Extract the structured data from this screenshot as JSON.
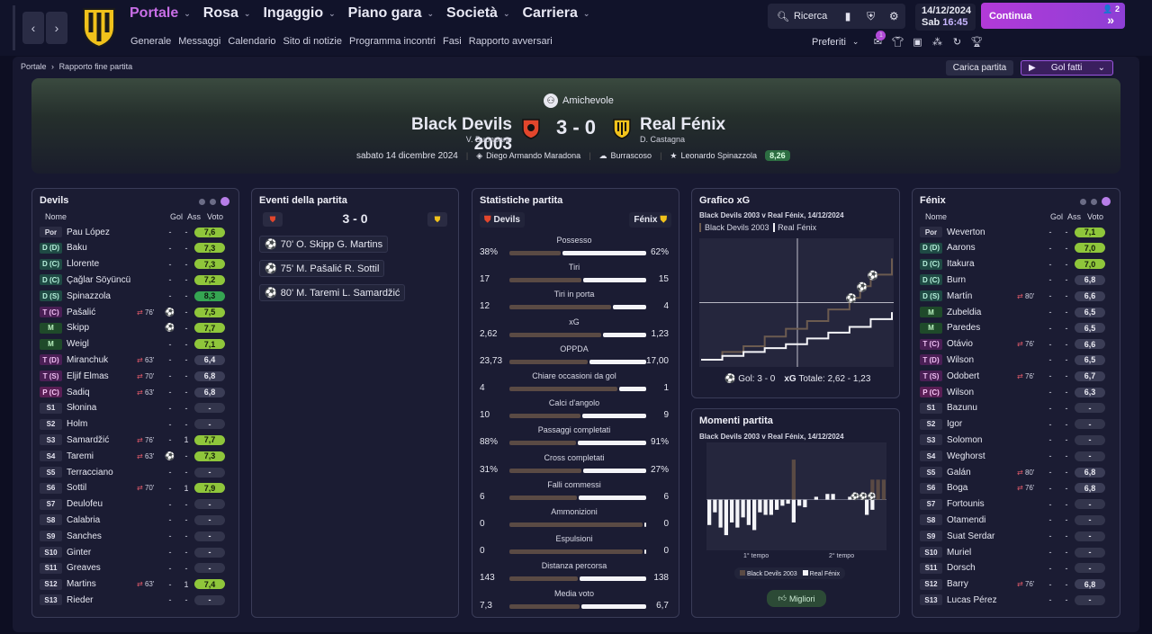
{
  "nav": {
    "menu": [
      {
        "label": "Portale",
        "active": true
      },
      {
        "label": "Rosa"
      },
      {
        "label": "Ingaggio"
      },
      {
        "label": "Piano gara"
      },
      {
        "label": "Società"
      },
      {
        "label": "Carriera"
      }
    ],
    "submenu": [
      "Generale",
      "Messaggi",
      "Calendario",
      "Sito di notizie",
      "Programma incontri",
      "Fasi",
      "Rapporto avversari"
    ],
    "search_label": "Ricerca",
    "date": "14/12/2024",
    "day": "Sab",
    "time": "16:45",
    "continue_label": "Continua",
    "continue_badge": "2",
    "favorites_label": "Preferiti",
    "notif_count": "1"
  },
  "breadcrumb": [
    "Portale",
    "Rapporto fine partita"
  ],
  "actions": {
    "load_match": "Carica partita",
    "goals_button": "Gol fatti"
  },
  "match": {
    "competition": "Amichevole",
    "home": "Black Devils 2003",
    "home_manager": "V. Buonpane",
    "away": "Real Fénix",
    "away_manager": "D. Castagna",
    "score": "3 - 0",
    "date": "sabato 14 dicembre 2024",
    "stadium": "Diego Armando Maradona",
    "weather": "Burrascoso",
    "mvp": "Leonardo Spinazzola",
    "mvp_rating": "8,26"
  },
  "home_panel": {
    "title": "Devils",
    "headers": {
      "name": "Nome",
      "gol": "Gol",
      "ass": "Ass",
      "voto": "Voto"
    },
    "players": [
      {
        "pos": "Por",
        "name": "Pau López",
        "sub": "",
        "gol": "-",
        "ass": "-",
        "voto": "7,6",
        "cls": "gk"
      },
      {
        "pos": "D (D)",
        "name": "Baku",
        "sub": "",
        "gol": "-",
        "ass": "-",
        "voto": "7,3",
        "cls": "d"
      },
      {
        "pos": "D (C)",
        "name": "Llorente",
        "sub": "",
        "gol": "-",
        "ass": "-",
        "voto": "7,3",
        "cls": "d"
      },
      {
        "pos": "D (C)",
        "name": "Çağlar Söyüncü",
        "sub": "",
        "gol": "-",
        "ass": "-",
        "voto": "7,2",
        "cls": "d"
      },
      {
        "pos": "D (S)",
        "name": "Spinazzola",
        "sub": "",
        "gol": "-",
        "ass": "-",
        "voto": "8,3",
        "cls": "d"
      },
      {
        "pos": "T (C)",
        "name": "Pašalić",
        "sub": "76'",
        "gol": "⚽",
        "ass": "-",
        "voto": "7,5",
        "cls": "t"
      },
      {
        "pos": "M",
        "name": "Skipp",
        "sub": "",
        "gol": "⚽",
        "ass": "-",
        "voto": "7,7",
        "cls": "m"
      },
      {
        "pos": "M",
        "name": "Weigl",
        "sub": "",
        "gol": "-",
        "ass": "-",
        "voto": "7,1",
        "cls": "m"
      },
      {
        "pos": "T (D)",
        "name": "Miranchuk",
        "sub": "63'",
        "gol": "-",
        "ass": "-",
        "voto": "6,4",
        "cls": "t"
      },
      {
        "pos": "T (S)",
        "name": "Eljif Elmas",
        "sub": "70'",
        "gol": "-",
        "ass": "-",
        "voto": "6,8",
        "cls": "t"
      },
      {
        "pos": "P (C)",
        "name": "Sadiq",
        "sub": "63'",
        "gol": "-",
        "ass": "-",
        "voto": "6,8",
        "cls": "p"
      },
      {
        "pos": "S1",
        "name": "Słonina",
        "sub": "",
        "gol": "-",
        "ass": "-",
        "voto": "-",
        "cls": "s"
      },
      {
        "pos": "S2",
        "name": "Holm",
        "sub": "",
        "gol": "-",
        "ass": "-",
        "voto": "-",
        "cls": "s"
      },
      {
        "pos": "S3",
        "name": "Samardžić",
        "sub": "76'",
        "gol": "-",
        "ass": "1",
        "voto": "7,7",
        "cls": "s"
      },
      {
        "pos": "S4",
        "name": "Taremi",
        "sub": "63'",
        "gol": "⚽",
        "ass": "-",
        "voto": "7,3",
        "cls": "s"
      },
      {
        "pos": "S5",
        "name": "Terracciano",
        "sub": "",
        "gol": "-",
        "ass": "-",
        "voto": "-",
        "cls": "s"
      },
      {
        "pos": "S6",
        "name": "Sottil",
        "sub": "70'",
        "gol": "-",
        "ass": "1",
        "voto": "7,9",
        "cls": "s"
      },
      {
        "pos": "S7",
        "name": "Deulofeu",
        "sub": "",
        "gol": "-",
        "ass": "-",
        "voto": "-",
        "cls": "s"
      },
      {
        "pos": "S8",
        "name": "Calabria",
        "sub": "",
        "gol": "-",
        "ass": "-",
        "voto": "-",
        "cls": "s"
      },
      {
        "pos": "S9",
        "name": "Sanches",
        "sub": "",
        "gol": "-",
        "ass": "-",
        "voto": "-",
        "cls": "s"
      },
      {
        "pos": "S10",
        "name": "Ginter",
        "sub": "",
        "gol": "-",
        "ass": "-",
        "voto": "-",
        "cls": "s"
      },
      {
        "pos": "S11",
        "name": "Greaves",
        "sub": "",
        "gol": "-",
        "ass": "-",
        "voto": "-",
        "cls": "s"
      },
      {
        "pos": "S12",
        "name": "Martins",
        "sub": "63'",
        "gol": "-",
        "ass": "1",
        "voto": "7,4",
        "cls": "s"
      },
      {
        "pos": "S13",
        "name": "Rieder",
        "sub": "",
        "gol": "-",
        "ass": "-",
        "voto": "-",
        "cls": "s"
      }
    ]
  },
  "away_panel": {
    "title": "Fénix",
    "headers": {
      "name": "Nome",
      "gol": "Gol",
      "ass": "Ass",
      "voto": "Voto"
    },
    "players": [
      {
        "pos": "Por",
        "name": "Weverton",
        "sub": "",
        "gol": "-",
        "ass": "-",
        "voto": "7,1",
        "cls": "gk"
      },
      {
        "pos": "D (D)",
        "name": "Aarons",
        "sub": "",
        "gol": "-",
        "ass": "-",
        "voto": "7,0",
        "cls": "d"
      },
      {
        "pos": "D (C)",
        "name": "Itakura",
        "sub": "",
        "gol": "-",
        "ass": "-",
        "voto": "7,0",
        "cls": "d"
      },
      {
        "pos": "D (C)",
        "name": "Burn",
        "sub": "",
        "gol": "-",
        "ass": "-",
        "voto": "6,8",
        "cls": "d"
      },
      {
        "pos": "D (S)",
        "name": "Martín",
        "sub": "80'",
        "gol": "-",
        "ass": "-",
        "voto": "6,6",
        "cls": "d"
      },
      {
        "pos": "M",
        "name": "Zubeldia",
        "sub": "",
        "gol": "-",
        "ass": "-",
        "voto": "6,5",
        "cls": "m"
      },
      {
        "pos": "M",
        "name": "Paredes",
        "sub": "",
        "gol": "-",
        "ass": "-",
        "voto": "6,5",
        "cls": "m"
      },
      {
        "pos": "T (C)",
        "name": "Otávio",
        "sub": "76'",
        "gol": "-",
        "ass": "-",
        "voto": "6,6",
        "cls": "t"
      },
      {
        "pos": "T (D)",
        "name": "Wilson",
        "sub": "",
        "gol": "-",
        "ass": "-",
        "voto": "6,5",
        "cls": "t"
      },
      {
        "pos": "T (S)",
        "name": "Odobert",
        "sub": "76'",
        "gol": "-",
        "ass": "-",
        "voto": "6,7",
        "cls": "t"
      },
      {
        "pos": "P (C)",
        "name": "Wilson",
        "sub": "",
        "gol": "-",
        "ass": "-",
        "voto": "6,3",
        "cls": "p"
      },
      {
        "pos": "S1",
        "name": "Bazunu",
        "sub": "",
        "gol": "-",
        "ass": "-",
        "voto": "-",
        "cls": "s"
      },
      {
        "pos": "S2",
        "name": "Igor",
        "sub": "",
        "gol": "-",
        "ass": "-",
        "voto": "-",
        "cls": "s"
      },
      {
        "pos": "S3",
        "name": "Solomon",
        "sub": "",
        "gol": "-",
        "ass": "-",
        "voto": "-",
        "cls": "s"
      },
      {
        "pos": "S4",
        "name": "Weghorst",
        "sub": "",
        "gol": "-",
        "ass": "-",
        "voto": "-",
        "cls": "s"
      },
      {
        "pos": "S5",
        "name": "Galán",
        "sub": "80'",
        "gol": "-",
        "ass": "-",
        "voto": "6,8",
        "cls": "s"
      },
      {
        "pos": "S6",
        "name": "Boga",
        "sub": "76'",
        "gol": "-",
        "ass": "-",
        "voto": "6,8",
        "cls": "s"
      },
      {
        "pos": "S7",
        "name": "Fortounis",
        "sub": "",
        "gol": "-",
        "ass": "-",
        "voto": "-",
        "cls": "s"
      },
      {
        "pos": "S8",
        "name": "Otamendi",
        "sub": "",
        "gol": "-",
        "ass": "-",
        "voto": "-",
        "cls": "s"
      },
      {
        "pos": "S9",
        "name": "Suat Serdar",
        "sub": "",
        "gol": "-",
        "ass": "-",
        "voto": "-",
        "cls": "s"
      },
      {
        "pos": "S10",
        "name": "Muriel",
        "sub": "",
        "gol": "-",
        "ass": "-",
        "voto": "-",
        "cls": "s"
      },
      {
        "pos": "S11",
        "name": "Dorsch",
        "sub": "",
        "gol": "-",
        "ass": "-",
        "voto": "-",
        "cls": "s"
      },
      {
        "pos": "S12",
        "name": "Barry",
        "sub": "76'",
        "gol": "-",
        "ass": "-",
        "voto": "6,8",
        "cls": "s"
      },
      {
        "pos": "S13",
        "name": "Lucas Pérez",
        "sub": "",
        "gol": "-",
        "ass": "-",
        "voto": "-",
        "cls": "s"
      }
    ]
  },
  "events": {
    "title": "Eventi della partita",
    "score": "3 - 0",
    "list": [
      {
        "text": "70' O. Skipp G. Martins"
      },
      {
        "text": "75' M. Pašalić R. Sottil"
      },
      {
        "text": "80' M. Taremi L. Samardžić"
      }
    ]
  },
  "stats": {
    "title": "Statistiche partita",
    "home": "Devils",
    "away": "Fénix",
    "rows": [
      {
        "label": "Possesso",
        "home": "38%",
        "away": "62%",
        "h": 38,
        "a": 62
      },
      {
        "label": "Tiri",
        "home": "17",
        "away": "15",
        "h": 17,
        "a": 15
      },
      {
        "label": "Tiri in porta",
        "home": "12",
        "away": "4",
        "h": 12,
        "a": 4
      },
      {
        "label": "xG",
        "home": "2,62",
        "away": "1,23",
        "h": 2.62,
        "a": 1.23
      },
      {
        "label": "OPPDA",
        "home": "23,73",
        "away": "17,00",
        "h": 23.73,
        "a": 17.0
      },
      {
        "label": "Chiare occasioni da gol",
        "home": "4",
        "away": "1",
        "h": 4,
        "a": 1
      },
      {
        "label": "Calci d'angolo",
        "home": "10",
        "away": "9",
        "h": 10,
        "a": 9
      },
      {
        "label": "Passaggi completati",
        "home": "88%",
        "away": "91%",
        "h": 88,
        "a": 91
      },
      {
        "label": "Cross completati",
        "home": "31%",
        "away": "27%",
        "h": 31,
        "a": 27
      },
      {
        "label": "Falli commessi",
        "home": "6",
        "away": "6",
        "h": 6,
        "a": 6
      },
      {
        "label": "Ammonizioni",
        "home": "0",
        "away": "0",
        "h": 0,
        "a": 0
      },
      {
        "label": "Espulsioni",
        "home": "0",
        "away": "0",
        "h": 0,
        "a": 0
      },
      {
        "label": "Distanza percorsa",
        "home": "143",
        "away": "138",
        "h": 143,
        "a": 138
      },
      {
        "label": "Media voto",
        "home": "7,3",
        "away": "6,7",
        "h": 7.3,
        "a": 6.7
      }
    ]
  },
  "xg": {
    "title": "Grafico xG",
    "subtitle": "Black Devils 2003 v Real Fénix, 14/12/2024",
    "legend_home": "Black Devils 2003",
    "legend_away": "Real Fénix",
    "footer_goals": "Gol: 3 - 0",
    "footer_xg": "Totale: 2,62 - 1,23"
  },
  "momentum": {
    "title": "Momenti partita",
    "subtitle": "Black Devils 2003 v Real Fénix, 14/12/2024",
    "first_half": "1° tempo",
    "second_half": "2° tempo",
    "legend_home": "Black Devils 2003",
    "legend_away": "Real Fénix",
    "button": "Migliori"
  },
  "chart_data": [
    {
      "type": "line",
      "title": "Grafico xG",
      "series": [
        {
          "name": "Black Devils 2003",
          "x": [
            0,
            10,
            20,
            30,
            40,
            50,
            60,
            70,
            75,
            80,
            90
          ],
          "y": [
            0,
            0.2,
            0.35,
            0.6,
            0.8,
            1.0,
            1.3,
            1.6,
            1.9,
            2.2,
            2.62
          ]
        },
        {
          "name": "Real Fénix",
          "x": [
            0,
            10,
            20,
            30,
            40,
            50,
            60,
            70,
            80,
            90
          ],
          "y": [
            0,
            0.1,
            0.2,
            0.3,
            0.4,
            0.55,
            0.7,
            0.85,
            1.05,
            1.23
          ]
        }
      ],
      "goals": [
        {
          "team": "Black Devils 2003",
          "minute": 70
        },
        {
          "team": "Black Devils 2003",
          "minute": 75
        },
        {
          "team": "Black Devils 2003",
          "minute": 80
        }
      ]
    },
    {
      "type": "bar",
      "title": "Momenti partita",
      "series": [
        {
          "name": "Black Devils 2003",
          "values": [
            0,
            0,
            0,
            0,
            0,
            0,
            0,
            0,
            0,
            0,
            0,
            0,
            0,
            0,
            0,
            0.7,
            0,
            0,
            0,
            0,
            0,
            0,
            0,
            0,
            0,
            0,
            0,
            0,
            0,
            0.35,
            0.35,
            0.35
          ]
        },
        {
          "name": "Real Fénix",
          "values": [
            -0.5,
            -0.25,
            -0.55,
            -0.7,
            -0.45,
            -0.55,
            -0.35,
            -0.5,
            -0.6,
            -0.25,
            -0.3,
            -0.3,
            -0.2,
            -0.12,
            -0.08,
            -0.45,
            -0.12,
            -0.15,
            0,
            0.05,
            0,
            0.1,
            0.1,
            0,
            0,
            0.05,
            0,
            0,
            -0.3,
            -0.2,
            0,
            0
          ]
        }
      ]
    }
  ]
}
